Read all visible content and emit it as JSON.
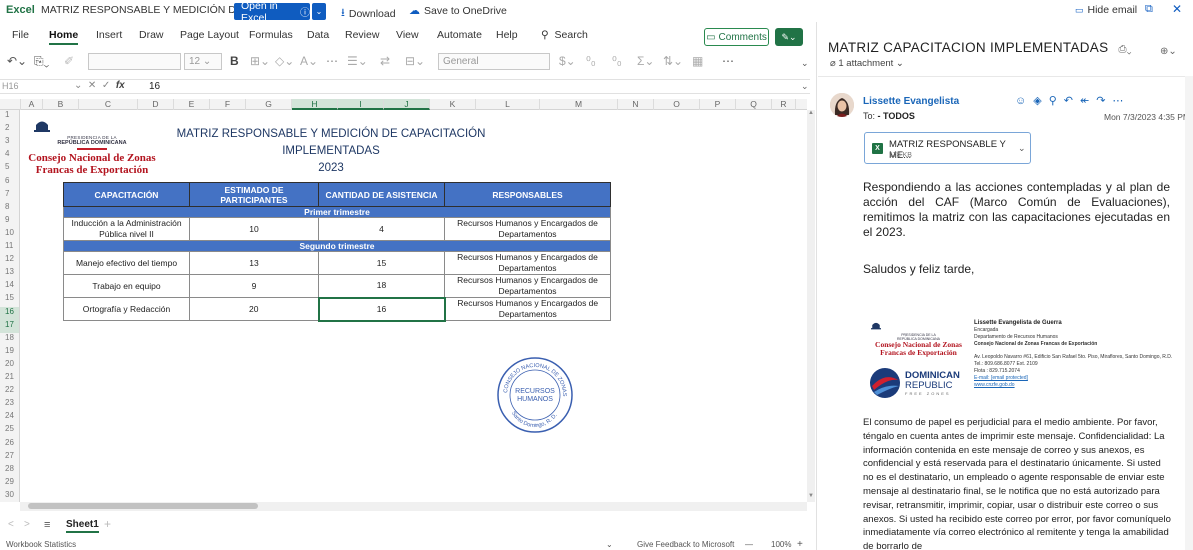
{
  "topbar": {
    "app_name": "Excel",
    "doc_title": "MATRIZ RESPONSABLE Y MEDICIÓN DE ...",
    "open_in_excel": "Open in Excel",
    "download": "Download",
    "save_onedrive": "Save to OneDrive",
    "hide_email": "Hide email"
  },
  "ribbon": {
    "tabs": [
      "File",
      "Home",
      "Insert",
      "Draw",
      "Page Layout",
      "Formulas",
      "Data",
      "Review",
      "View",
      "Automate",
      "Help"
    ],
    "search": "Search",
    "comments": "Comments"
  },
  "toolbar": {
    "font_size": "12",
    "number_format": "General"
  },
  "formula_bar": {
    "name_box": "H16",
    "value": "16"
  },
  "grid": {
    "columns": [
      "A",
      "B",
      "C",
      "D",
      "E",
      "F",
      "G",
      "H",
      "I",
      "J",
      "K",
      "L",
      "M",
      "N",
      "O",
      "P",
      "Q",
      "R"
    ],
    "rows": [
      "1",
      "2",
      "3",
      "4",
      "5",
      "6",
      "7",
      "8",
      "9",
      "10",
      "11",
      "12",
      "13",
      "14",
      "15",
      "16",
      "17",
      "18",
      "19",
      "20",
      "21",
      "22",
      "23",
      "24",
      "25",
      "26",
      "27",
      "28",
      "29",
      "30"
    ]
  },
  "sheet": {
    "logo_presidencia": "PRESIDENCIA DE LA",
    "logo_republica": "REPÚBLICA DOMINICANA",
    "logo_cnzfe_1": "Consejo Nacional de Zonas",
    "logo_cnzfe_2": "Francas de Exportación",
    "title_line1": "MATRIZ RESPONSABLE Y MEDICIÓN DE CAPACITACIÓN IMPLEMENTADAS",
    "title_line2": "2023",
    "headers": [
      "CAPACITACIÓN",
      "ESTIMADO DE PARTICIPANTES",
      "CANTIDAD DE ASISTENCIA",
      "RESPONSABLES"
    ],
    "section1": "Primer trimestre",
    "section2": "Segundo trimestre",
    "rows": [
      {
        "capacitacion": "Inducción a la Administración Pública nivel II",
        "estimado": "10",
        "asistencia": "4",
        "responsables": "Recursos Humanos y Encargados de Departamentos"
      },
      {
        "capacitacion": "Manejo efectivo del tiempo",
        "estimado": "13",
        "asistencia": "15",
        "responsables": "Recursos Humanos y Encargados de Departamentos"
      },
      {
        "capacitacion": "Trabajo en equipo",
        "estimado": "9",
        "asistencia": "18",
        "responsables": "Recursos Humanos y Encargados de Departamentos"
      },
      {
        "capacitacion": "Ortografía y Redacción",
        "estimado": "20",
        "asistencia": "16",
        "responsables": "Recursos Humanos y Encargados de Departamentos"
      }
    ],
    "seal_top": "CONSEJO NACIONAL DE ZONAS FRANCAS",
    "seal_center_1": "RECURSOS",
    "seal_center_2": "HUMANOS",
    "seal_bottom": "Santo Domingo, R. D."
  },
  "sheet_tabs": {
    "active": "Sheet1"
  },
  "status": {
    "left": "Workbook Statistics",
    "feedback": "Give Feedback to Microsoft",
    "zoom": "100%"
  },
  "email": {
    "subject": "MATRIZ CAPACITACION IMPLEMENTADAS",
    "attachment_count": "1 attachment",
    "sender": "Lissette Evangelista",
    "to_label": "To:",
    "to_value": "- TODOS",
    "date": "Mon 7/3/2023 4:35 PM",
    "attachment_name": "MATRIZ RESPONSABLE Y ME...",
    "attachment_size": "178 KB",
    "body_paragraph": "Respondiendo a las acciones contempladas y al plan de acción del CAF (Marco Común de Evaluaciones), remitimos la matriz con las capacitaciones ejecutadas en el 2023.",
    "greeting": "Saludos y feliz tarde,",
    "disclaimer": "El consumo de papel es perjudicial para el medio ambiente. Por favor, téngalo en cuenta antes de imprimir este mensaje. Confidencialidad: La información contenida en este mensaje de correo y sus anexos, es confidencial y está reservada para el destinatario únicamente. Si usted no es el destinatario, un empleado o agente responsable de enviar este mensaje al destinatario final, se le notifica que no está autorizado para revisar, retransmitir, imprimir, copiar, usar o distribuir este correo o sus anexos. Si usted ha recibido este correo por error, por favor comuníquelo inmediatamente vía correo electrónico al remitente y tenga la amabilidad de borrarlo de"
  },
  "signature": {
    "name": "Lissette Evangelista de Guerra",
    "role": "Encargada",
    "dept": "Departamento de Recursos Humanos",
    "org": "Consejo Nacional de Zonas Francas de Exportación",
    "address": "Av. Leopoldo Navarro #61, Edificio San Rafael 5to. Piso, Miraflores, Santo Domingo, R.D.",
    "tel": "Tel.: 809.686.8077 Ext. 2109",
    "flota": "Flota : 829.715.2074",
    "email": "E-mail: [email protected]",
    "web": "www.cnzfe.gob.do",
    "dr_1": "DOMINICAN",
    "dr_2": "REPUBLIC",
    "dr_3": "FREE ZONES"
  },
  "colors": {
    "excel_green": "#217346",
    "open_blue": "#0f5cc0",
    "table_header": "#4472c4",
    "cnzfe_red": "#b3141f",
    "link_blue": "#1a66b8"
  }
}
